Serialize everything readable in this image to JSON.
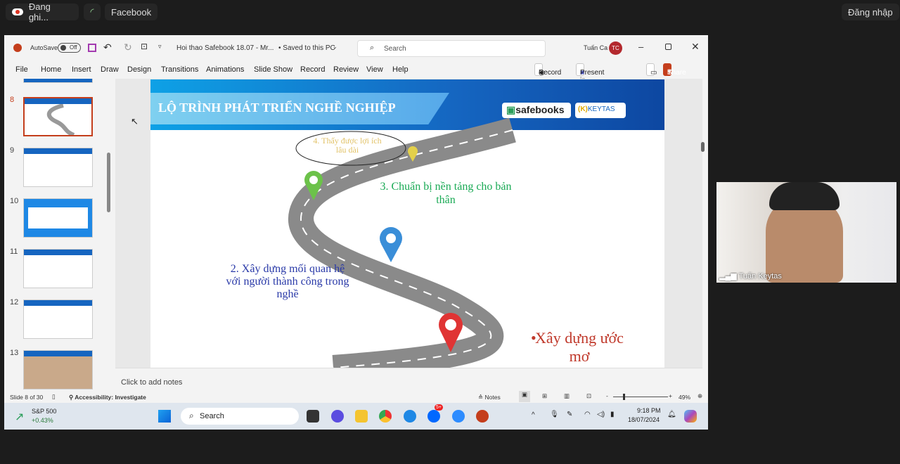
{
  "meeting_bar": {
    "recording_label": "Đang ghi...",
    "facebook_label": "Facebook",
    "login_label": "Đăng nhập"
  },
  "title_bar": {
    "autosave_label": "AutoSave",
    "autosave_state": "Off",
    "doc_title": "Hoi thao Safebook 18.07 - Mr...",
    "save_status": "• Saved to this PC",
    "search_placeholder": "Search",
    "user_name": "Tuấn Ca",
    "user_initials": "TC"
  },
  "ribbon": {
    "tabs": [
      "File",
      "Home",
      "Insert",
      "Draw",
      "Design",
      "Transitions",
      "Animations",
      "Slide Show",
      "Record",
      "Review",
      "View",
      "Help"
    ],
    "record_label": "Record",
    "present_teams_label": "Present in Teams",
    "share_label": "Share"
  },
  "thumbnails": {
    "numbers": [
      "8",
      "9",
      "10",
      "11",
      "12",
      "13"
    ],
    "selected": "8"
  },
  "slide": {
    "title": "LỘ TRÌNH PHÁT TRIỂN NGHỀ NGHIỆP",
    "logo_safebooks": "safebooks",
    "logo_keytas": "KEYTAS",
    "step4": "4. Thấy được lợi ích lâu dài",
    "step3": "3. Chuẩn bị nền tảng cho bản thân",
    "step2": "2. Xây dựng mối quan hệ với người thành công trong nghề",
    "step1": "Xây dựng ước mơ"
  },
  "notes_placeholder": "Click to add notes",
  "status_bar": {
    "slide_info": "Slide 8 of 30",
    "accessibility": "Accessibility: Investigate",
    "notes_label": "Notes",
    "zoom": "49%"
  },
  "taskbar": {
    "stock_name": "S&P 500",
    "stock_change": "+0.43%",
    "search_label": "Search",
    "time": "9:18 PM",
    "date": "18/07/2024",
    "zalo_badge": "5+"
  },
  "video": {
    "participant_name": "Tuấn Keytas"
  },
  "colors": {
    "accent": "#c43e1c",
    "slide_blue": "#1565c0",
    "step3": "#1aaa55",
    "step2": "#2a3aa8",
    "step1": "#c0392b",
    "step4": "#e2c36a"
  }
}
